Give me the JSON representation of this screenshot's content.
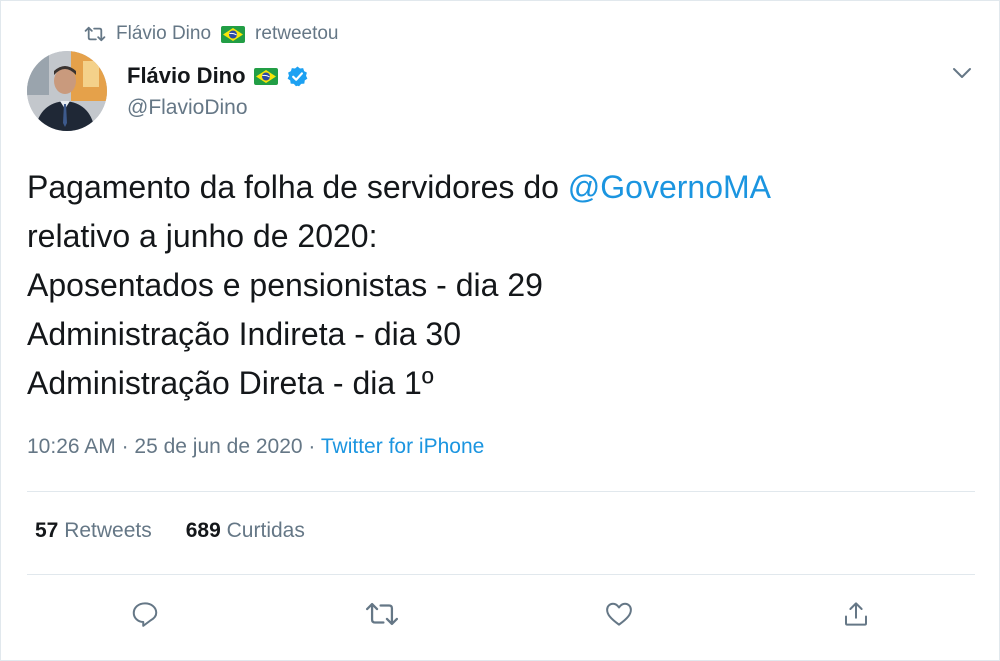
{
  "retweet_context": {
    "name": "Flávio Dino",
    "action": "retweetou"
  },
  "author": {
    "display_name": "Flávio Dino",
    "handle": "@FlavioDino",
    "verified": true
  },
  "tweet": {
    "text_lines": [
      {
        "before": "Pagamento da folha de servidores do ",
        "mention": "@GovernoMA"
      },
      {
        "text": "relativo a junho de 2020:"
      },
      {
        "text": "Aposentados e pensionistas - dia 29"
      },
      {
        "text": "Administração Indireta - dia 30"
      },
      {
        "text": "Administração Direta - dia 1º"
      }
    ]
  },
  "meta": {
    "time": "10:26 AM",
    "sep": "·",
    "date": "25 de jun de 2020",
    "source": "Twitter for iPhone"
  },
  "stats": {
    "retweets_count": "57",
    "retweets_label": "Retweets",
    "likes_count": "689",
    "likes_label": "Curtidas"
  },
  "icons": {
    "retweet": "retweet-icon",
    "flag": "brazil-flag-icon",
    "verified": "verified-badge-icon",
    "chevron": "chevron-down-icon",
    "reply": "reply-icon",
    "like": "heart-icon",
    "share": "share-icon"
  },
  "colors": {
    "link": "#1b95e0",
    "secondary": "#657786",
    "verified": "#1da1f2",
    "divider": "#e1e8ed"
  }
}
